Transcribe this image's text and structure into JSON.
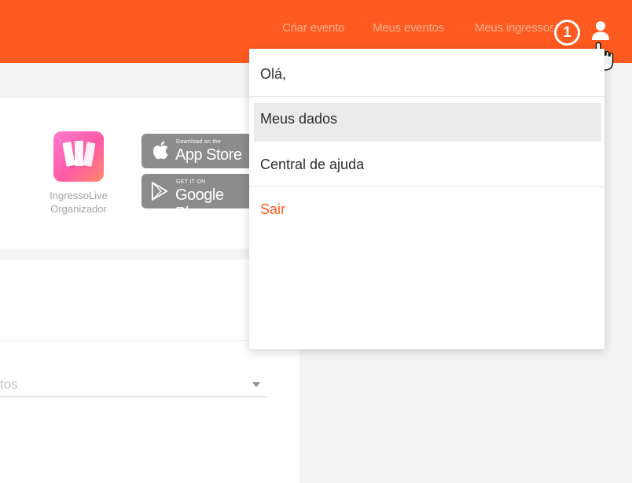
{
  "header": {
    "nav": [
      "Criar evento",
      "Meus eventos",
      "Meus ingressos"
    ],
    "step_number": "1"
  },
  "app_promo": {
    "app_name_line1": "IngressoLive",
    "app_name_line2": "Organizador",
    "app_store": {
      "small": "Download on the",
      "big": "App Store"
    },
    "google_play": {
      "small": "GET IT ON",
      "big": "Google Play"
    }
  },
  "form": {
    "select_value": "tos"
  },
  "user_menu": {
    "greeting": "Olá,",
    "items": [
      "Meus dados",
      "Central de ajuda",
      "Sair"
    ]
  },
  "colors": {
    "brand": "#ff5a1f",
    "nav_text": "#ffb08c",
    "menu_highlight": "#ebebeb"
  },
  "icons": [
    "user-icon",
    "pointer-hand-icon",
    "apple-icon",
    "google-play-icon",
    "dropdown-caret-icon"
  ]
}
